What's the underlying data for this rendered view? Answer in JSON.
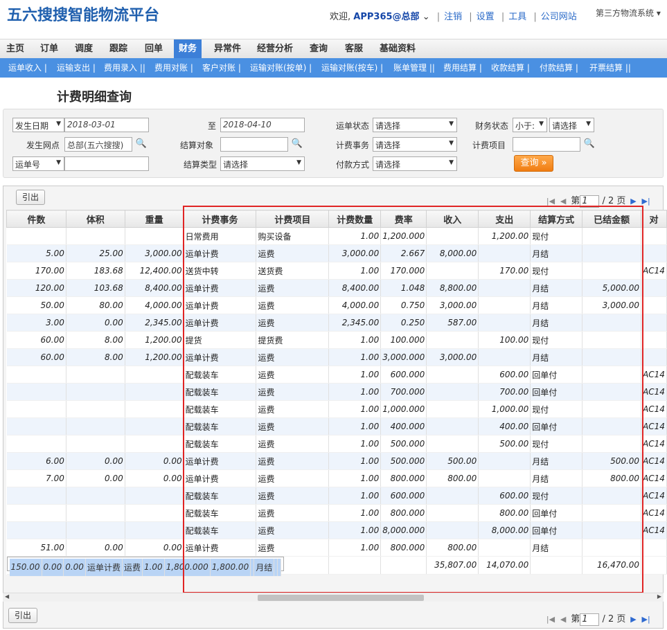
{
  "header": {
    "logo": "五六搜搜智能物流平台",
    "welcome_prefix": "欢迎,",
    "user": "APP365@总部",
    "links": [
      "注销",
      "设置",
      "工具",
      "公司网站"
    ],
    "system_select": "第三方物流系统"
  },
  "mainnav": [
    "主页",
    "订单",
    "调度",
    "跟踪",
    "回单",
    "财务",
    "异常件",
    "经营分析",
    "查询",
    "客服",
    "基础资料"
  ],
  "active_tab": "财务",
  "subnav": [
    "运单收入 |",
    "运输支出 |",
    "费用录入 ||",
    "费用对账 |",
    "客户对账 |",
    "运输对账(按单) |",
    "运输对账(按车) |",
    "账单管理 ||",
    "费用结算 |",
    "收款结算 |",
    "付款结算 |",
    "开票结算 ||"
  ],
  "page_title": "计费明细查询",
  "filters": {
    "date_type": "发生日期",
    "date_from": "2018-03-01",
    "to_label": "至",
    "date_to": "2018-04-10",
    "waybill_status_label": "运单状态",
    "waybill_status": "请选择",
    "finance_status_label": "财务状态",
    "finance_op": "小于:",
    "finance_status": "请选择",
    "site_label": "发生网点",
    "site_value": "总部(五六搜搜)",
    "settle_obj_label": "结算对象",
    "settle_obj_value": "",
    "billing_item_label": "计费事务",
    "billing_item": "请选择",
    "fee_item_label": "计费项目",
    "fee_item_value": "",
    "waybill_no_type": "运单号",
    "waybill_no_value": "",
    "settle_type_label": "结算类型",
    "settle_type": "请选择",
    "pay_method_label": "付款方式",
    "pay_method": "请选择",
    "query_button": "查询 »"
  },
  "grid": {
    "export_label": "引出",
    "pager": {
      "page_label": "第",
      "page_value": "1",
      "total_label": "/ 2 页"
    },
    "columns": [
      "件数",
      "体积",
      "重量",
      "计费事务",
      "计费项目",
      "计费数量",
      "费率",
      "收入",
      "支出",
      "结算方式",
      "已结金额",
      "对"
    ],
    "rows": [
      [
        "",
        "",
        "",
        "日常费用",
        "购买设备",
        "1.00",
        "1,200.000",
        "",
        "1,200.00",
        "现付",
        "",
        ""
      ],
      [
        "5.00",
        "25.00",
        "3,000.00",
        "运单计费",
        "运费",
        "3,000.00",
        "2.667",
        "8,000.00",
        "",
        "月结",
        "",
        ""
      ],
      [
        "170.00",
        "183.68",
        "12,400.00",
        "送货中转",
        "送货费",
        "1.00",
        "170.000",
        "",
        "170.00",
        "现付",
        "",
        "AC14"
      ],
      [
        "120.00",
        "103.68",
        "8,400.00",
        "运单计费",
        "运费",
        "8,400.00",
        "1.048",
        "8,800.00",
        "",
        "月结",
        "5,000.00",
        ""
      ],
      [
        "50.00",
        "80.00",
        "4,000.00",
        "运单计费",
        "运费",
        "4,000.00",
        "0.750",
        "3,000.00",
        "",
        "月结",
        "3,000.00",
        ""
      ],
      [
        "3.00",
        "0.00",
        "2,345.00",
        "运单计费",
        "运费",
        "2,345.00",
        "0.250",
        "587.00",
        "",
        "月结",
        "",
        ""
      ],
      [
        "60.00",
        "8.00",
        "1,200.00",
        "提货",
        "提货费",
        "1.00",
        "100.000",
        "",
        "100.00",
        "现付",
        "",
        ""
      ],
      [
        "60.00",
        "8.00",
        "1,200.00",
        "运单计费",
        "运费",
        "1.00",
        "3,000.000",
        "3,000.00",
        "",
        "月结",
        "",
        ""
      ],
      [
        "",
        "",
        "",
        "配载装车",
        "运费",
        "1.00",
        "600.000",
        "",
        "600.00",
        "回单付",
        "",
        "AC14"
      ],
      [
        "",
        "",
        "",
        "配载装车",
        "运费",
        "1.00",
        "700.000",
        "",
        "700.00",
        "回单付",
        "",
        "AC14"
      ],
      [
        "",
        "",
        "",
        "配载装车",
        "运费",
        "1.00",
        "1,000.000",
        "",
        "1,000.00",
        "现付",
        "",
        "AC14"
      ],
      [
        "",
        "",
        "",
        "配载装车",
        "运费",
        "1.00",
        "400.000",
        "",
        "400.00",
        "回单付",
        "",
        "AC14"
      ],
      [
        "",
        "",
        "",
        "配载装车",
        "运费",
        "1.00",
        "500.000",
        "",
        "500.00",
        "现付",
        "",
        "AC14"
      ],
      [
        "6.00",
        "0.00",
        "0.00",
        "运单计费",
        "运费",
        "1.00",
        "500.000",
        "500.00",
        "",
        "月结",
        "500.00",
        "AC14"
      ],
      [
        "7.00",
        "0.00",
        "0.00",
        "运单计费",
        "运费",
        "1.00",
        "800.000",
        "800.00",
        "",
        "月结",
        "800.00",
        "AC14"
      ],
      [
        "",
        "",
        "",
        "配载装车",
        "运费",
        "1.00",
        "600.000",
        "",
        "600.00",
        "现付",
        "",
        "AC14"
      ],
      [
        "",
        "",
        "",
        "配载装车",
        "运费",
        "1.00",
        "800.000",
        "",
        "800.00",
        "回单付",
        "",
        "AC14"
      ],
      [
        "",
        "",
        "",
        "配载装车",
        "运费",
        "1.00",
        "8,000.000",
        "",
        "8,000.00",
        "回单付",
        "",
        "AC14"
      ],
      [
        "51.00",
        "0.00",
        "0.00",
        "运单计费",
        "运费",
        "1.00",
        "800.000",
        "800.00",
        "",
        "月结",
        "",
        ""
      ],
      [
        "150.00",
        "0.00",
        "0.00",
        "运单计费",
        "运费",
        "1.00",
        "1,800.000",
        "1,800.00",
        "",
        "月结",
        "",
        ""
      ]
    ],
    "totals": [
      "",
      "",
      "",
      "",
      "",
      "",
      "",
      "35,807.00",
      "14,070.00",
      "",
      "16,470.00",
      ""
    ],
    "selected_row": 19
  }
}
